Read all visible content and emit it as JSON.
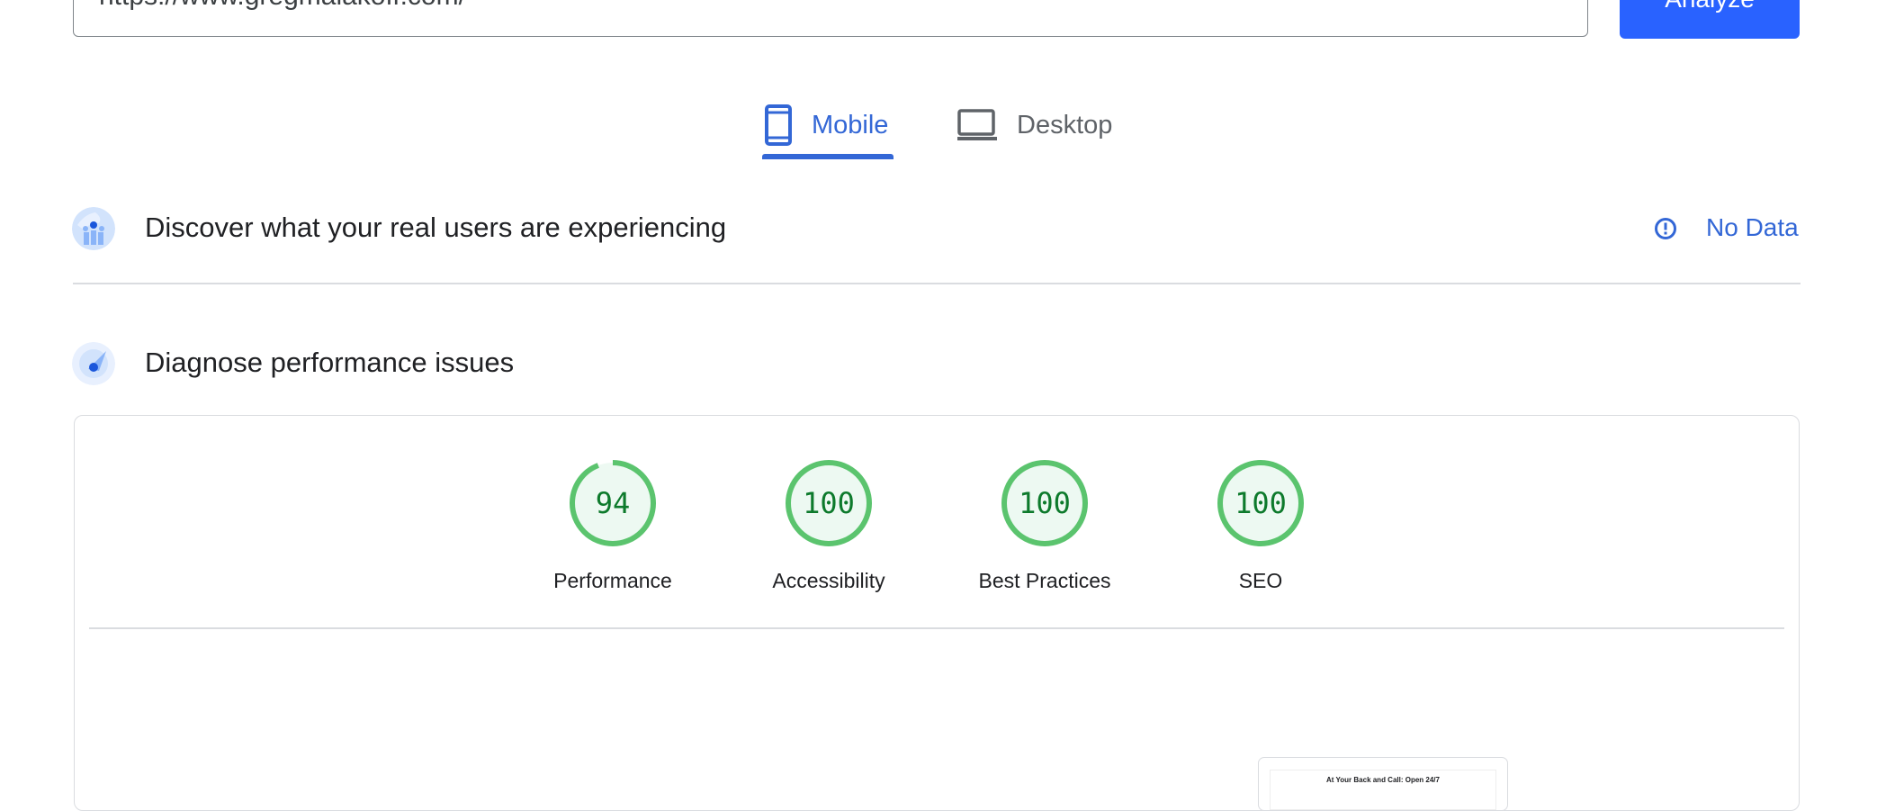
{
  "search": {
    "url_value": "https://www.gregmalakoff.com/",
    "analyze_label": "Analyze"
  },
  "tabs": [
    {
      "label": "Mobile",
      "icon": "smartphone-icon",
      "active": true
    },
    {
      "label": "Desktop",
      "icon": "laptop-icon",
      "active": false
    }
  ],
  "field_data": {
    "title": "Discover what your real users are experiencing",
    "status": "No Data",
    "status_icon": "alert-circle-icon"
  },
  "lab_data": {
    "title": "Diagnose performance issues"
  },
  "scores": [
    {
      "label": "Performance",
      "value": 94
    },
    {
      "label": "Accessibility",
      "value": 100
    },
    {
      "label": "Best Practices",
      "value": 100
    },
    {
      "label": "SEO",
      "value": 100
    }
  ],
  "screenshot_thumb": {
    "text": "At Your Back and Call: Open 24/7"
  },
  "colors": {
    "accent": "#3367d6",
    "button": "#2962ff",
    "pass_green": "#0cce6b",
    "pass_text": "#0d7a2c"
  }
}
